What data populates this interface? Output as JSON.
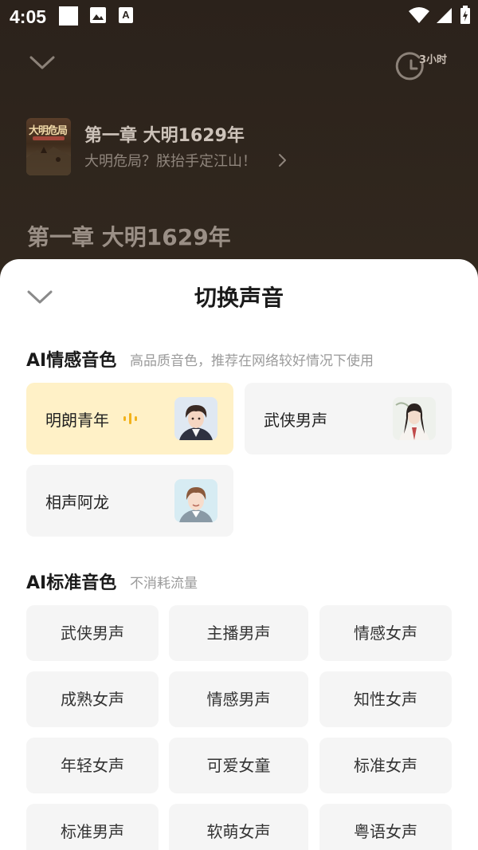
{
  "status_bar": {
    "time": "4:05",
    "icons": [
      "square-icon",
      "image-icon",
      "a-icon",
      "wifi-icon",
      "signal-icon",
      "battery-icon"
    ]
  },
  "player": {
    "timer_label": "3小时",
    "book_cover_title": "大明危局",
    "chapter_title": "第一章 大明1629年",
    "book_subtitle": "大明危局？朕抬手定江山！",
    "content_heading": "第一章 大明1629年"
  },
  "sheet": {
    "title": "切换声音",
    "ai_emotion": {
      "title": "AI情感音色",
      "subtitle": "高品质音色，推荐在网络较好情况下使用",
      "voices": [
        {
          "label": "明朗青年",
          "selected": true
        },
        {
          "label": "武侠男声",
          "selected": false
        },
        {
          "label": "相声阿龙",
          "selected": false
        }
      ]
    },
    "ai_standard": {
      "title": "AI标准音色",
      "subtitle": "不消耗流量",
      "voices": [
        {
          "label": "武侠男声"
        },
        {
          "label": "主播男声"
        },
        {
          "label": "情感女声"
        },
        {
          "label": "成熟女声"
        },
        {
          "label": "情感男声"
        },
        {
          "label": "知性女声"
        },
        {
          "label": "年轻女声"
        },
        {
          "label": "可爱女童"
        },
        {
          "label": "标准女声"
        },
        {
          "label": "标准男声"
        },
        {
          "label": "软萌女声"
        },
        {
          "label": "粤语女声"
        }
      ]
    }
  },
  "colors": {
    "selected_card": "#fff1c7",
    "accent_wave": "#f2b21b",
    "card_bg": "#f5f5f5"
  }
}
